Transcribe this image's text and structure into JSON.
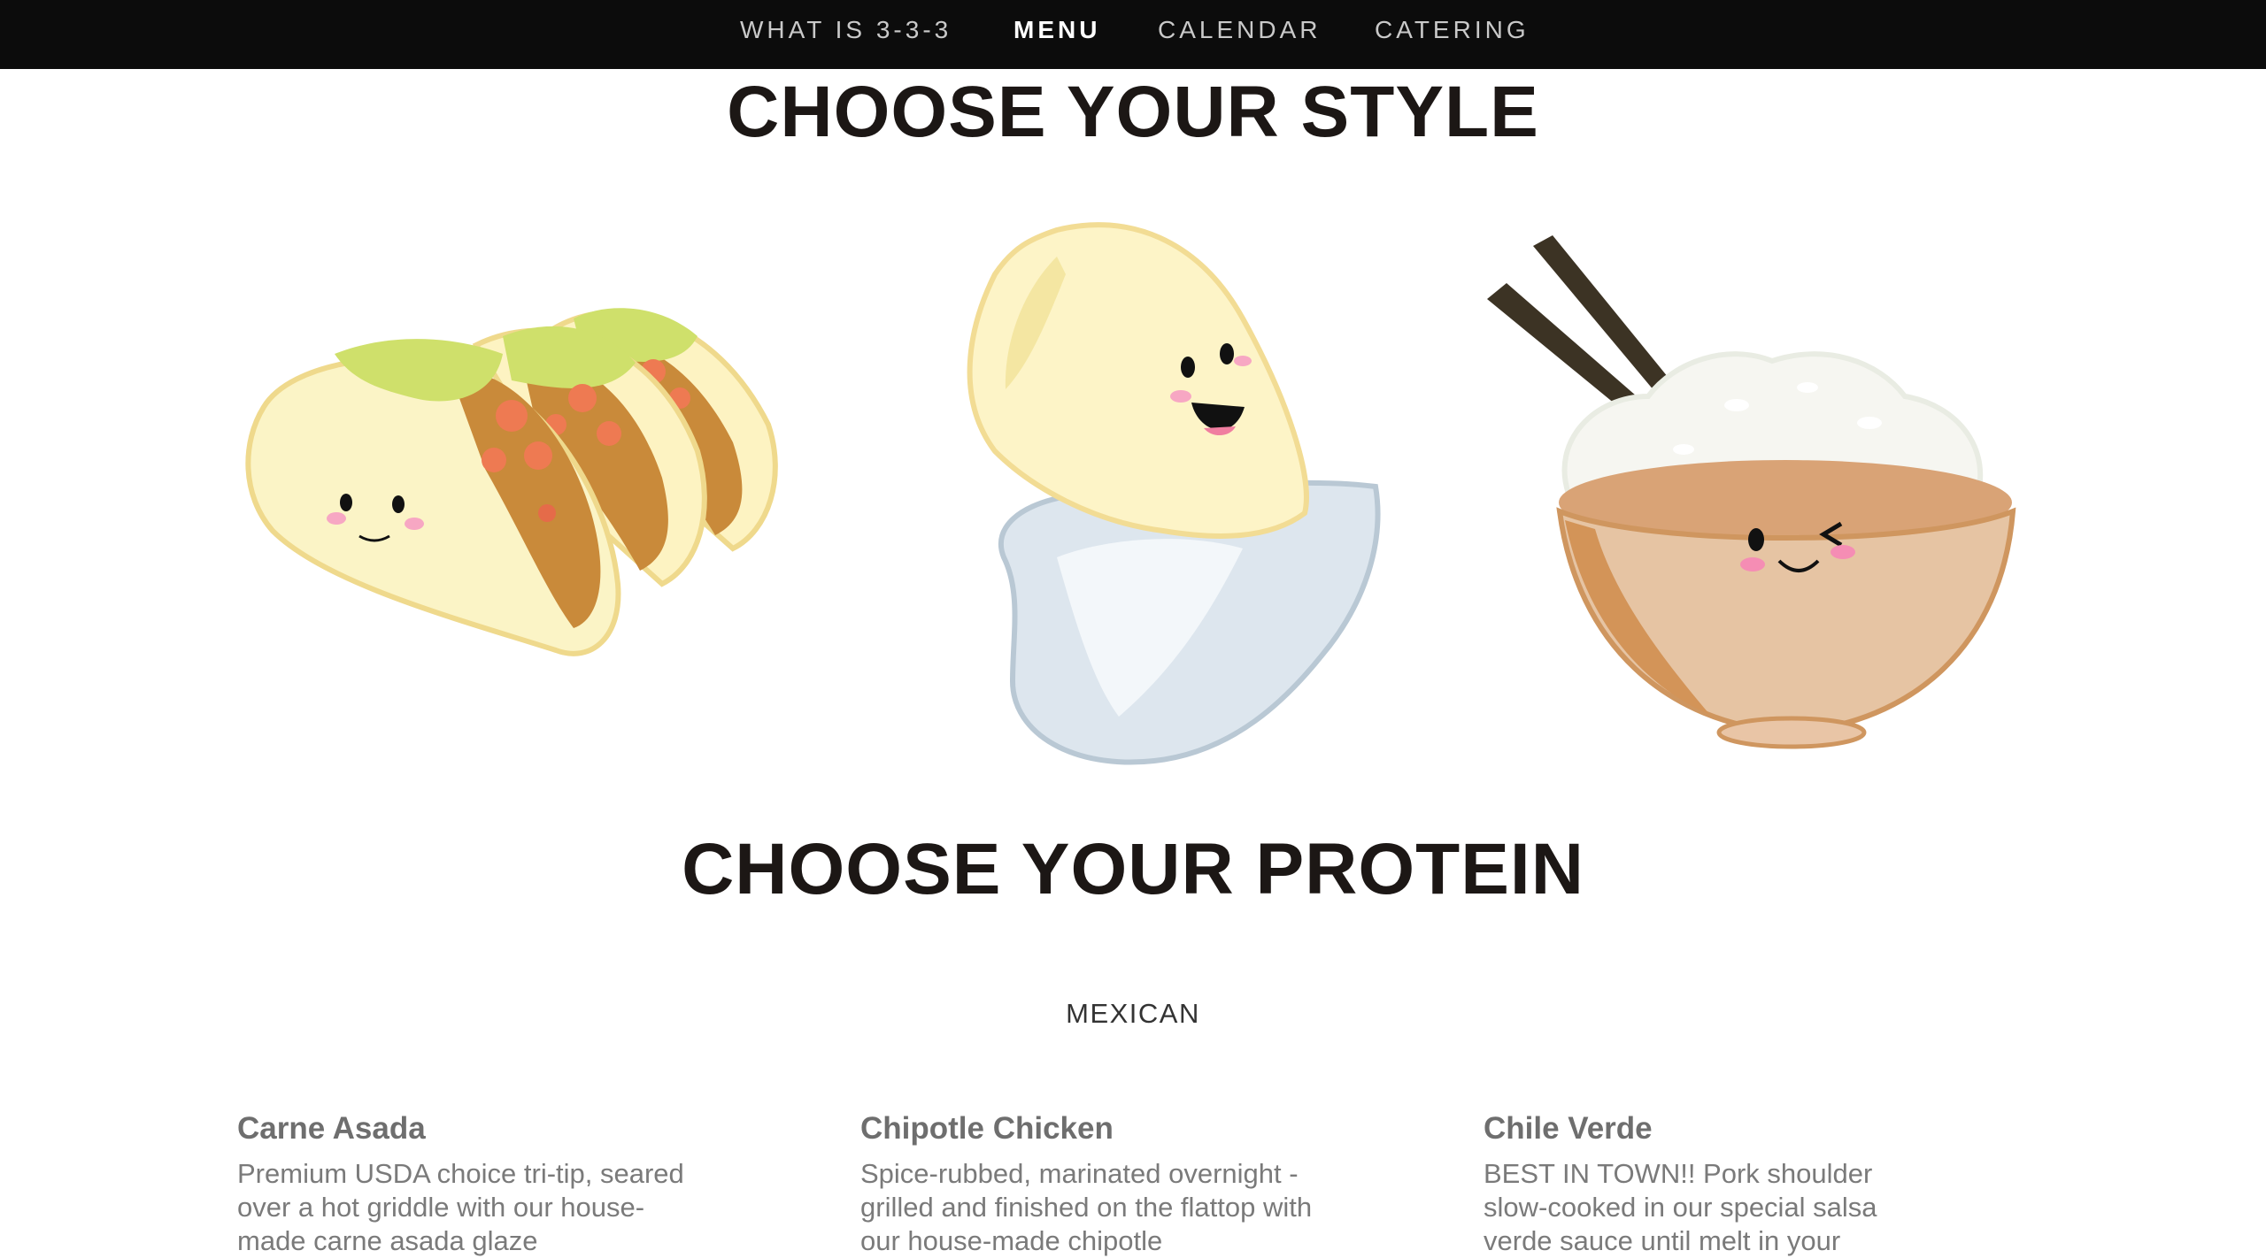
{
  "nav": {
    "items": [
      {
        "label": "WHAT IS 3-3-3",
        "active": false
      },
      {
        "label": "MENU",
        "active": true
      },
      {
        "label": "CALENDAR",
        "active": false
      },
      {
        "label": "CATERING",
        "active": false
      }
    ]
  },
  "style_section": {
    "title": "CHOOSE YOUR STYLE",
    "options": [
      {
        "icon": "taco-icon"
      },
      {
        "icon": "burrito-icon"
      },
      {
        "icon": "rice-bowl-icon"
      }
    ]
  },
  "protein_section": {
    "title": "CHOOSE YOUR PROTEIN",
    "category": "MEXICAN",
    "items": [
      {
        "name": "Carne Asada",
        "description": "Premium USDA choice tri-tip, seared over a hot griddle with our house-made carne asada glaze"
      },
      {
        "name": "Chipotle Chicken",
        "description": "Spice-rubbed, marinated overnight - grilled and finished on the flattop with our house-made chipotle"
      },
      {
        "name": "Chile Verde",
        "description": "BEST IN TOWN!! Pork shoulder slow-cooked in our special salsa verde sauce until melt in your"
      }
    ]
  },
  "colors": {
    "nav_bg": "#0c0c0c",
    "heading": "#1c1715",
    "body_text": "#7a7a7a"
  }
}
